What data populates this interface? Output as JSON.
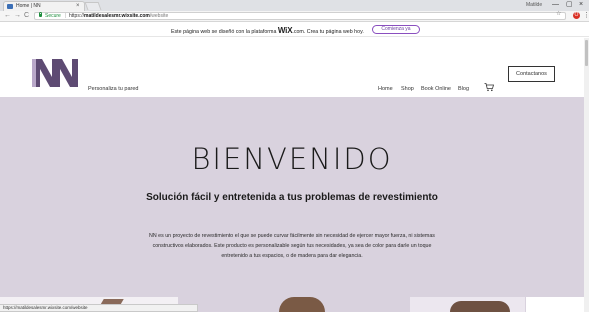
{
  "browser": {
    "tab_title": "Home | NN",
    "tab_close": "×",
    "profile_name": "Matilde",
    "window_controls": {
      "minimize": "—",
      "maximize": "▢",
      "close": "×"
    },
    "nav": {
      "back": "←",
      "forward": "→",
      "reload": "C"
    },
    "secure_label": "Secure",
    "url_scheme": "https://",
    "url_host": "matildesalesmr.wixsite.com",
    "url_path": "/website",
    "star_icon": "☆",
    "extension_badge": "O",
    "menu_icon": "⋮",
    "status_url": "https://matildesalesmr.wixsite.com/website"
  },
  "wix_banner": {
    "text_before": "Este página web se diseñó con la plataforma ",
    "brand": "WiX",
    "text_after": ".com. Crea tu página web hoy.",
    "cta": "Comienza ya"
  },
  "header": {
    "tagline": "Personaliza tu pared",
    "nav": [
      "Home",
      "Shop",
      "Book Online",
      "Blog"
    ],
    "contact_button": "Contactanos"
  },
  "hero": {
    "title": "BIENVENIDO",
    "subtitle": "Solución fácil y entretenida a tus problemas de revestimiento",
    "body": "NN es un proyecto de revestimiento el que se puede curvar fácilmente sin necesidad de ejercer mayor fuerza, ni sistemas constructivos elaborados. Este producto es personalizable según tus necesidades, ya sea de color para darle un toque entretenido a tus espacios, o de madera para dar elegancia."
  },
  "colors": {
    "hero_bg": "#d9d2de",
    "logo": "#5e4b73",
    "wix_accent": "#8a4fbf",
    "secure_green": "#1e8e3e"
  }
}
